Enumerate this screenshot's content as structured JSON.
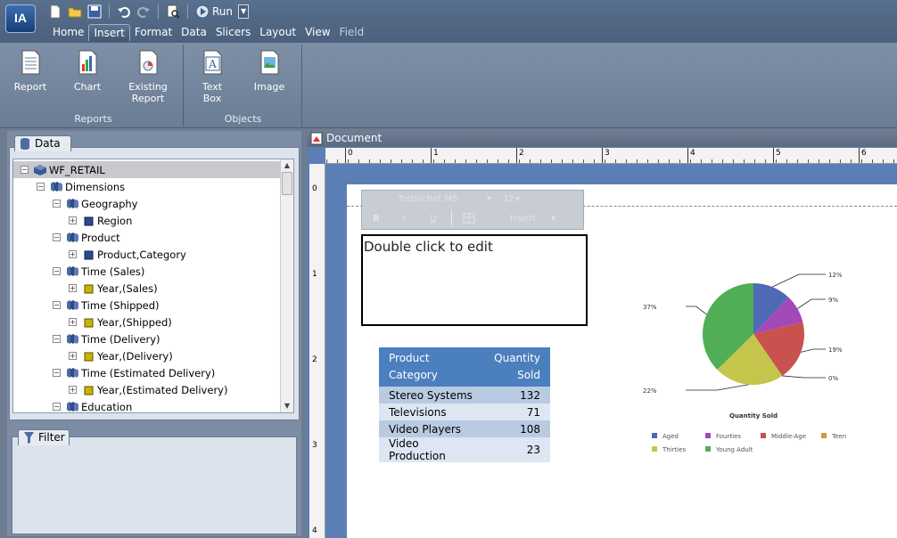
{
  "app": {
    "logo_text": "IA",
    "run_label": "Run",
    "menu": [
      "Home",
      "Insert",
      "Format",
      "Data",
      "Slicers",
      "Layout",
      "View",
      "Field"
    ],
    "active_menu": "Insert"
  },
  "ribbon": {
    "groups": [
      {
        "title": "Reports",
        "buttons": [
          "Report",
          "Chart",
          "Existing Report"
        ]
      },
      {
        "title": "Objects",
        "buttons": [
          "Text Box",
          "Image"
        ]
      }
    ]
  },
  "data_panel": {
    "tab": "Data",
    "tree": [
      {
        "label": "WF_RETAIL",
        "icon": "cube-icon",
        "expander": "−"
      },
      {
        "label": "Dimensions",
        "icon": "dimension-icon",
        "expander": "−"
      },
      {
        "label": "Geography",
        "icon": "dimension-icon",
        "expander": "−"
      },
      {
        "label": "Region",
        "icon": "hierarchy-icon",
        "expander": "+"
      },
      {
        "label": "Product",
        "icon": "dimension-icon",
        "expander": "−"
      },
      {
        "label": "Product,Category",
        "icon": "hierarchy-icon",
        "expander": "+"
      },
      {
        "label": "Time (Sales)",
        "icon": "dimension-icon",
        "expander": "−"
      },
      {
        "label": "Year,(Sales)",
        "icon": "time-hierarchy-icon",
        "expander": "+"
      },
      {
        "label": "Time (Shipped)",
        "icon": "dimension-icon",
        "expander": "−"
      },
      {
        "label": "Year,(Shipped)",
        "icon": "time-hierarchy-icon",
        "expander": "+"
      },
      {
        "label": "Time (Delivery)",
        "icon": "dimension-icon",
        "expander": "−"
      },
      {
        "label": "Year,(Delivery)",
        "icon": "time-hierarchy-icon",
        "expander": "+"
      },
      {
        "label": "Time (Estimated Delivery)",
        "icon": "dimension-icon",
        "expander": "−"
      },
      {
        "label": "Year,(Estimated Delivery)",
        "icon": "time-hierarchy-icon",
        "expander": "+"
      },
      {
        "label": "Education",
        "icon": "dimension-icon",
        "expander": "−"
      }
    ]
  },
  "filter_panel": {
    "tab": "Filter"
  },
  "document": {
    "title": "Document",
    "ruler_h": [
      "0",
      "1",
      "2",
      "3",
      "4",
      "5",
      "6"
    ],
    "ruler_v": [
      "0",
      "1",
      "2",
      "3",
      "4"
    ],
    "format_toolbar": {
      "font": "Trebuchet MS",
      "size": "12",
      "bold": "B",
      "italic": "I",
      "underline": "U",
      "insert": "Insert"
    },
    "textbox_placeholder": "Double click to edit",
    "table": {
      "headers": [
        [
          "Product",
          "Category"
        ],
        [
          "Quantity",
          "Sold"
        ]
      ],
      "rows": [
        [
          "Stereo Systems",
          "132"
        ],
        [
          "Televisions",
          "71"
        ],
        [
          "Video Players",
          "108"
        ],
        [
          "Video Production",
          "23"
        ]
      ]
    }
  },
  "chart_data": {
    "type": "pie",
    "title": "Quantity Sold",
    "series": [
      {
        "name": "Aged",
        "value": 12,
        "color": "#4f6ab5"
      },
      {
        "name": "Fourties",
        "value": 9,
        "color": "#a348b8"
      },
      {
        "name": "Middle-Age",
        "value": 19,
        "color": "#c9524e"
      },
      {
        "name": "Teen",
        "value": 0,
        "color": "#c89a4a"
      },
      {
        "name": "Thirties",
        "value": 22,
        "color": "#c3c64b"
      },
      {
        "name": "Young Adult",
        "value": 37,
        "color": "#4fae56"
      }
    ],
    "labels": [
      "12%",
      "9%",
      "19%",
      "0%",
      "22%",
      "37%"
    ],
    "legend_placement": "bottom"
  }
}
